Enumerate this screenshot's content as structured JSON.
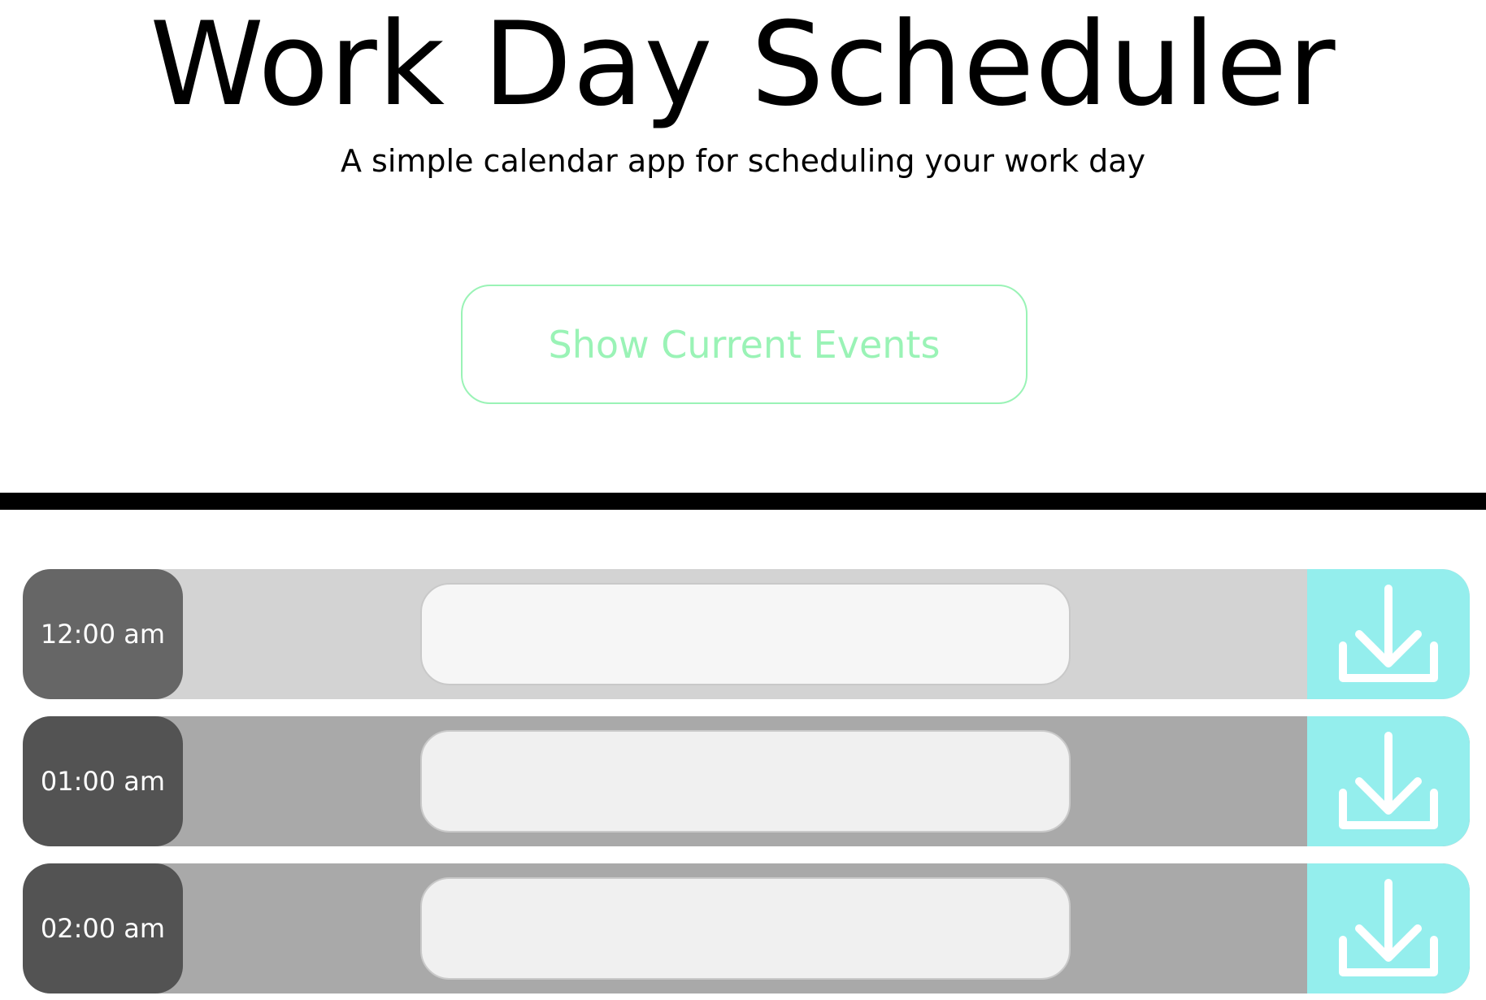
{
  "header": {
    "title": "Work Day Scheduler",
    "subtitle": "A simple calendar app for scheduling your work day"
  },
  "show_button": {
    "label": "Show Current Events",
    "color": "#9af3b6"
  },
  "save_icon": "download-icon",
  "colors": {
    "past_row": "#d3d3d3",
    "past_hour": "#666666",
    "past_input": "#f6f6f6",
    "future_row": "#a9a9a9",
    "future_hour": "#535353",
    "future_input": "#f0f0f0",
    "save": "#94eeed"
  },
  "time_blocks": [
    {
      "hour": "12:00 am",
      "event": "",
      "state": "past"
    },
    {
      "hour": "01:00 am",
      "event": "",
      "state": "future"
    },
    {
      "hour": "02:00 am",
      "event": "",
      "state": "future"
    }
  ]
}
